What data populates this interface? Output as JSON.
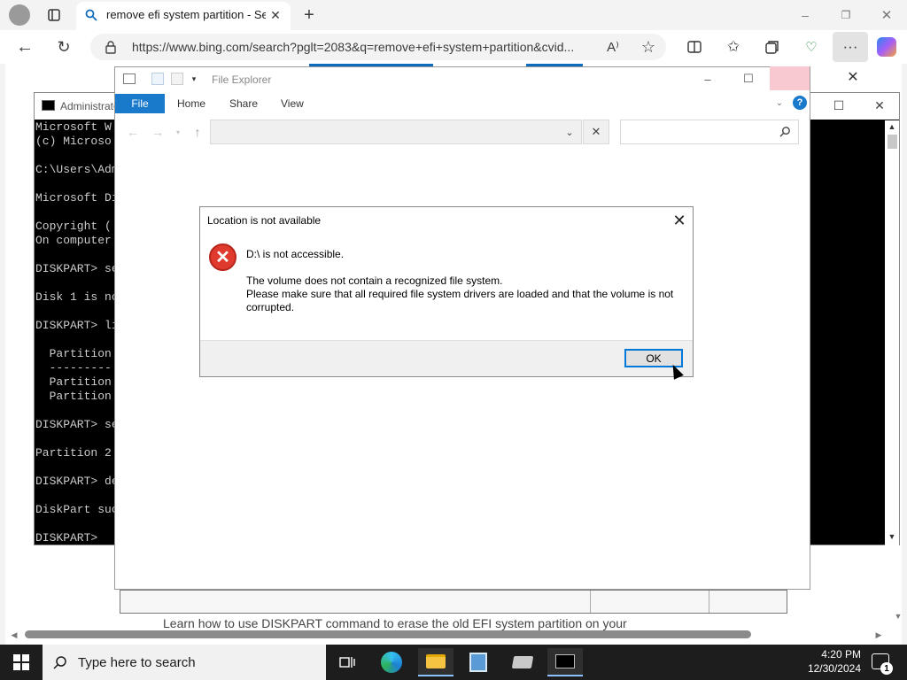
{
  "browser": {
    "tab_title": "remove efi system partition - Search",
    "url": "https://www.bing.com/search?pglt=2083&q=remove+efi+system+partition&cvid..."
  },
  "web": {
    "caption": "Learn how to use DISKPART command to erase the old EFI system partition on your"
  },
  "cmd": {
    "title": "Administrator",
    "lines": "Microsoft W\n(c) Microso\n\nC:\\Users\\Adm\n\nMicrosoft Di\n\nCopyright (\nOn computer\n\nDISKPART> se\n\nDisk 1 is no\n\nDISKPART> li\n\n  Partition\n  ---------\n  Partition\n  Partition\n\nDISKPART> se\n\nPartition 2\n\nDISKPART> de\n\nDiskPart suc\n\nDISKPART> "
  },
  "explorer": {
    "title": "File Explorer",
    "tabs": [
      "File",
      "Home",
      "Share",
      "View"
    ]
  },
  "dialog": {
    "title": "Location is not available",
    "heading": "D:\\ is not accessible.",
    "line1": "The volume does not contain a recognized file system.",
    "line2": "Please make sure that all required file system drivers are loaded and that the volume is not",
    "line3": "corrupted.",
    "ok": "OK"
  },
  "taskbar": {
    "search_placeholder": "Type here to search",
    "time": "4:20 PM",
    "date": "12/30/2024",
    "notification_count": "1"
  },
  "colors": {
    "accent": "#0078d7",
    "error": "#e03a2e",
    "ribbon": "#1979ca"
  }
}
